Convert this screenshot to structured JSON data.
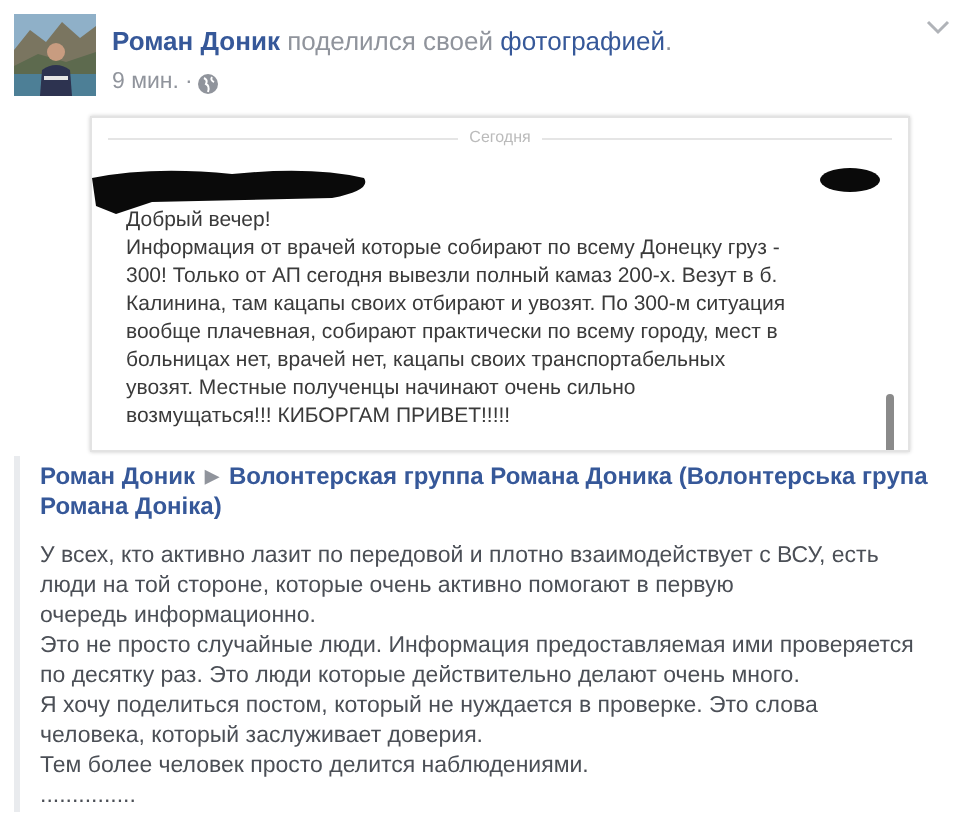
{
  "post": {
    "author": "Роман Доник",
    "action": "поделился своей",
    "object": "фотографией",
    "period": ".",
    "time": "9 мин.",
    "separator": "·"
  },
  "photo": {
    "divider": "Сегодня",
    "lines": [
      "Добрый вечер!",
      "Информация от врачей которые собирают по всему Донецку груз -",
      "300! Только от АП сегодня вывезли полный камаз 200-х. Везут в б.",
      "Калинина, там кацапы своих отбирают и увозят. По 300-м ситуация",
      "вообще плачевная, собирают практически по всему городу, мест в",
      "больницах нет, врачей нет, кацапы своих транспортабельных",
      "увозят. Местные полученцы начинают очень сильно",
      "возмущаться!!! КИБОРГАМ ПРИВЕТ!!!!!"
    ]
  },
  "shared": {
    "author": "Роман Доник",
    "arrow": "▶",
    "group": [
      "Волонтерская группа Романа Доника (Волонтерська група",
      "Романа Доніка)"
    ],
    "lines": [
      "У всех, кто активно лазит по передовой и плотно взаимодействует с ВСУ, есть",
      "люди на той стороне, которые очень активно помогают в первую",
      "очередь информационно.",
      "Это не просто случайные люди. Информация предоставляемая ими проверяется",
      "по десятку раз. Это люди которые действительно делают очень много.",
      "Я хочу поделиться постом, который не нуждается в проверке. Это слова",
      "человека, который заслуживает доверия.",
      "Тем более человек просто делится наблюдениями.",
      "..............."
    ]
  }
}
